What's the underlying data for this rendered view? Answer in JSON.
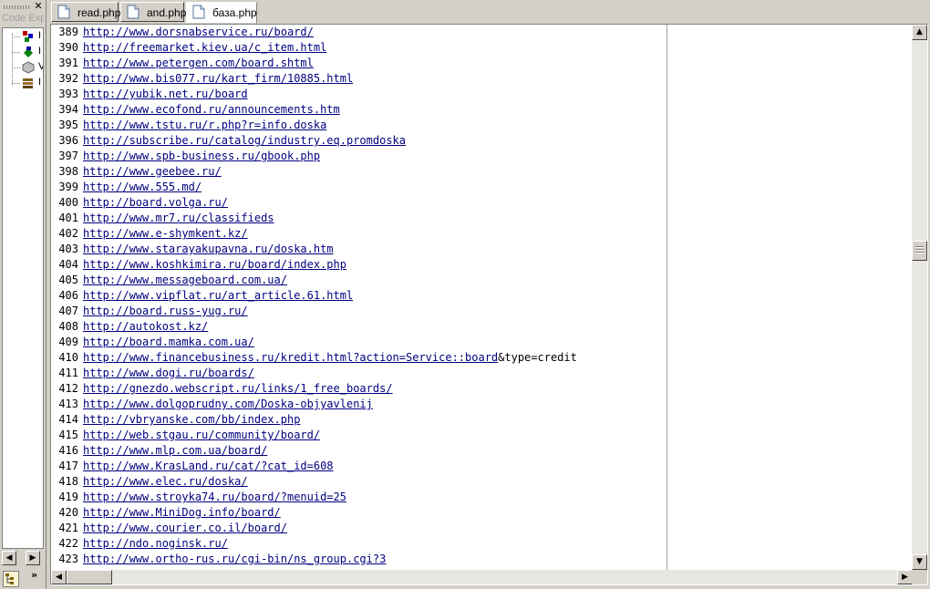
{
  "panel": {
    "title": "Code Exp",
    "close_glyph": "✕",
    "tree_labels": [
      "I",
      "I",
      "V",
      "I"
    ],
    "scroll_left": "◀",
    "scroll_right": "▶",
    "expand_glyph": "»"
  },
  "tabs": [
    {
      "label": "read.php",
      "active": false
    },
    {
      "label": "and.php",
      "active": false
    },
    {
      "label": "база.php",
      "active": true
    }
  ],
  "editor": {
    "lines": [
      {
        "num": "389",
        "url": "http://www.dorsnabservice.ru/board/",
        "rest": ""
      },
      {
        "num": "390",
        "url": "http://freemarket.kiev.ua/c_item.html",
        "rest": ""
      },
      {
        "num": "391",
        "url": "http://www.petergen.com/board.shtml",
        "rest": ""
      },
      {
        "num": "392",
        "url": "http://www.bis077.ru/kart_firm/10885.html",
        "rest": ""
      },
      {
        "num": "393",
        "url": "http://yubik.net.ru/board",
        "rest": ""
      },
      {
        "num": "394",
        "url": "http://www.ecofond.ru/announcements.htm",
        "rest": ""
      },
      {
        "num": "395",
        "url": "http://www.tstu.ru/r.php?r=info.doska",
        "rest": ""
      },
      {
        "num": "396",
        "url": "http://subscribe.ru/catalog/industry.eq.promdoska",
        "rest": ""
      },
      {
        "num": "397",
        "url": "http://www.spb-business.ru/gbook.php",
        "rest": ""
      },
      {
        "num": "398",
        "url": "http://www.geebee.ru/",
        "rest": ""
      },
      {
        "num": "399",
        "url": "http://www.555.md/",
        "rest": ""
      },
      {
        "num": "400",
        "url": "http://board.volga.ru/",
        "rest": ""
      },
      {
        "num": "401",
        "url": "http://www.mr7.ru/classifieds",
        "rest": ""
      },
      {
        "num": "402",
        "url": "http://www.e-shymkent.kz/",
        "rest": ""
      },
      {
        "num": "403",
        "url": "http://www.starayakupavna.ru/doska.htm",
        "rest": ""
      },
      {
        "num": "404",
        "url": "http://www.koshkimira.ru/board/index.php",
        "rest": ""
      },
      {
        "num": "405",
        "url": "http://www.messageboard.com.ua/",
        "rest": ""
      },
      {
        "num": "406",
        "url": "http://www.vipflat.ru/art_article.61.html",
        "rest": ""
      },
      {
        "num": "407",
        "url": "http://board.russ-yug.ru/",
        "rest": ""
      },
      {
        "num": "408",
        "url": "http://autokost.kz/",
        "rest": ""
      },
      {
        "num": "409",
        "url": "http://board.mamka.com.ua/",
        "rest": ""
      },
      {
        "num": "410",
        "url": "http://www.financebusiness.ru/kredit.html?action=Service::board",
        "rest": "&type=credit"
      },
      {
        "num": "411",
        "url": "http://www.dogi.ru/boards/",
        "rest": ""
      },
      {
        "num": "412",
        "url": "http://gnezdo.webscript.ru/links/1_free_boards/",
        "rest": ""
      },
      {
        "num": "413",
        "url": "http://www.dolgoprudny.com/Doska-objyavlenij",
        "rest": ""
      },
      {
        "num": "414",
        "url": "http://vbryanske.com/bb/index.php",
        "rest": ""
      },
      {
        "num": "415",
        "url": "http://web.stgau.ru/community/board/",
        "rest": ""
      },
      {
        "num": "416",
        "url": "http://www.mlp.com.ua/board/",
        "rest": ""
      },
      {
        "num": "417",
        "url": "http://www.KrasLand.ru/cat/?cat_id=608",
        "rest": ""
      },
      {
        "num": "418",
        "url": "http://www.elec.ru/doska/",
        "rest": ""
      },
      {
        "num": "419",
        "url": "http://www.stroyka74.ru/board/?menuid=25",
        "rest": ""
      },
      {
        "num": "420",
        "url": "http://www.MiniDog.info/board/",
        "rest": ""
      },
      {
        "num": "421",
        "url": "http://www.courier.co.il/board/",
        "rest": ""
      },
      {
        "num": "422",
        "url": "http://ndo.noginsk.ru/",
        "rest": ""
      },
      {
        "num": "423",
        "url": "http://www.ortho-rus.ru/cgi-bin/ns_group.cgi?3",
        "rest": ""
      }
    ],
    "scroll_up": "▲",
    "scroll_down": "▼",
    "scroll_left": "◀",
    "scroll_right": "▶"
  }
}
